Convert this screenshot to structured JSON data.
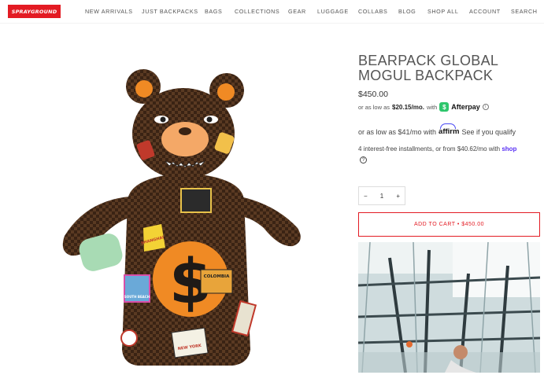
{
  "header": {
    "logo_text": "SPRAYGROUND",
    "nav": [
      "NEW ARRIVALS",
      "JUST BACKPACKS",
      "BAGS",
      "COLLECTIONS",
      "GEAR",
      "LUGGAGE",
      "COLLABS",
      "BLOG",
      "SHOP ALL",
      "ACCOUNT",
      "SEARCH"
    ]
  },
  "product": {
    "title_line1": "BEARPACK GLOBAL",
    "title_line2": "MOGUL BACKPACK",
    "price": "$450.00",
    "afterpay": {
      "prefix": "or as low as",
      "amount": "$20.15/mo.",
      "with": "with",
      "badge": "$",
      "brand": "Afterpay",
      "info": "i"
    },
    "affirm": {
      "text": "or as low as $41/mo with",
      "brand": "affirm",
      "cta": "See if you qualify"
    },
    "shop_pay": {
      "text": "4 interest-free installments, or from $40.62/mo with",
      "brand": "shop",
      "help": "?"
    },
    "quantity": {
      "minus": "−",
      "value": "1",
      "plus": "+"
    },
    "add_to_cart": "ADD TO CART • $450.00",
    "patches": {
      "shanghai": "SHANGHAI",
      "colombia": "COLOMBIA",
      "new_york": "NEW YORK",
      "south_beach": "SOUTH BEACH",
      "dollar": "$"
    }
  },
  "colors": {
    "brand_red": "#e31b23",
    "afterpay_green": "#2ec66c",
    "affirm_blue": "#4a4af4",
    "shop_purple": "#5a31f4"
  }
}
